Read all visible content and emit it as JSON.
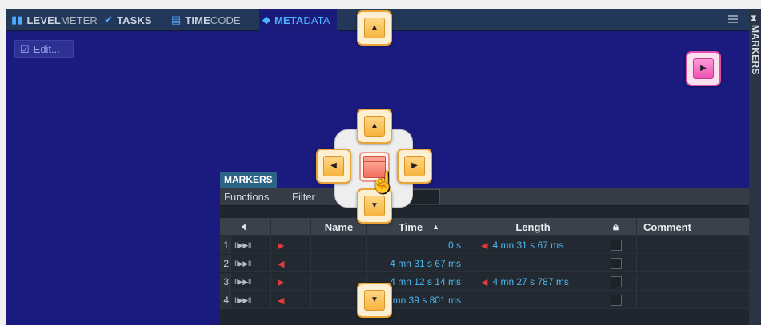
{
  "tabs": [
    {
      "icon": "levelmeter-icon",
      "glyph": "▮▮",
      "bold": "LEVEL",
      "rest": "METER",
      "active": false
    },
    {
      "icon": "tasks-check-icon",
      "glyph": "✔",
      "bold": "TASKS",
      "rest": "",
      "active": false
    },
    {
      "icon": "timecode-icon",
      "glyph": "▤",
      "bold": "TIME",
      "rest": "CODE",
      "active": false
    },
    {
      "icon": "metadata-tag-icon",
      "glyph": "◆",
      "bold": "META",
      "rest": "DATA",
      "active": true
    }
  ],
  "edit_button": {
    "label": "Edit..."
  },
  "side_tab": {
    "label": "MARKERS"
  },
  "markers_panel": {
    "title": "MARKERS",
    "menu": {
      "functions": "Functions",
      "filter": "Filter"
    },
    "columns": {
      "name": "Name",
      "time": "Time",
      "length": "Length",
      "comment": "Comment"
    },
    "rows": [
      {
        "num": "1",
        "controls": "II▶▶II",
        "flag": "▶",
        "time": "0 s",
        "length": "4 mn 31 s 67 ms"
      },
      {
        "num": "2",
        "controls": "II▶▶II",
        "flag": "◀",
        "time": "4 mn 31 s 67 ms",
        "length": ""
      },
      {
        "num": "3",
        "controls": "II▶▶II",
        "flag": "▶",
        "time": "4 mn 12 s 14 ms",
        "length": "4 mn 27 s 787 ms"
      },
      {
        "num": "4",
        "controls": "II▶▶II",
        "flag": "◀",
        "time": "8 mn 39 s 801 ms",
        "length": ""
      }
    ]
  },
  "dock_arrows": {
    "up": "▲",
    "down": "▼",
    "left": "◀",
    "right": "▶"
  }
}
